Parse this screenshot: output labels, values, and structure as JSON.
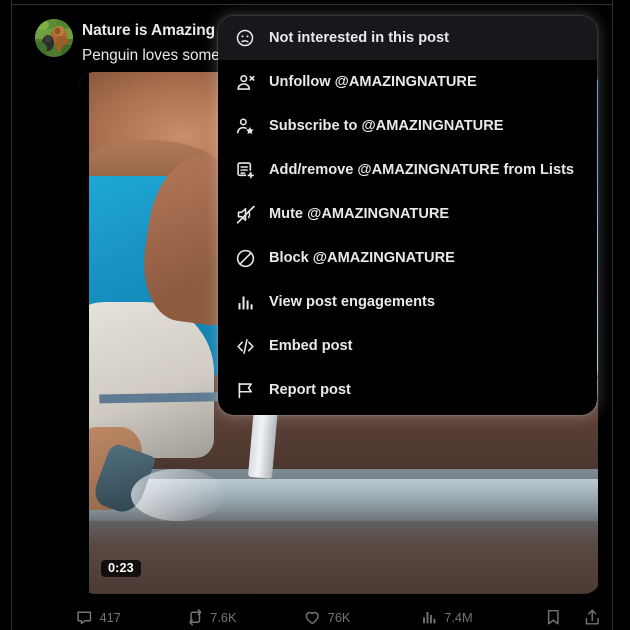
{
  "post": {
    "author_name": "Nature is Amazing",
    "verified_badge": "verified-gold-icon",
    "text": "Penguin loves some",
    "avatar_alt": "orangutan-avatar",
    "video_duration": "0:23"
  },
  "actions": {
    "reply": {
      "icon": "reply-icon",
      "count": "417"
    },
    "repost": {
      "icon": "repost-icon",
      "count": "7.6K"
    },
    "like": {
      "icon": "heart-icon",
      "count": "76K"
    },
    "views": {
      "icon": "bar-chart-icon",
      "count": "7.4M"
    },
    "bookmark": {
      "icon": "bookmark-icon",
      "count": ""
    },
    "share": {
      "icon": "share-icon",
      "count": ""
    }
  },
  "menu": {
    "items": [
      {
        "icon": "frown-face-icon",
        "label": "Not interested in this post",
        "hovered": true
      },
      {
        "icon": "person-remove-icon",
        "label": "Unfollow @AMAZINGNATURE",
        "hovered": false
      },
      {
        "icon": "person-star-icon",
        "label": "Subscribe to @AMAZINGNATURE",
        "hovered": false
      },
      {
        "icon": "list-add-icon",
        "label": "Add/remove @AMAZINGNATURE from Lists",
        "hovered": false
      },
      {
        "icon": "mute-icon",
        "label": "Mute @AMAZINGNATURE",
        "hovered": false
      },
      {
        "icon": "block-icon",
        "label": "Block @AMAZINGNATURE",
        "hovered": false
      },
      {
        "icon": "analytics-icon",
        "label": "View post engagements",
        "hovered": false
      },
      {
        "icon": "code-icon",
        "label": "Embed post",
        "hovered": false
      },
      {
        "icon": "flag-icon",
        "label": "Report post",
        "hovered": false
      }
    ]
  },
  "colors": {
    "background": "#000000",
    "text_primary": "#e7e9ea",
    "text_muted": "#71767b",
    "border": "#2f3336",
    "hover": "#16181c",
    "verified_gold": "#e2b719"
  }
}
